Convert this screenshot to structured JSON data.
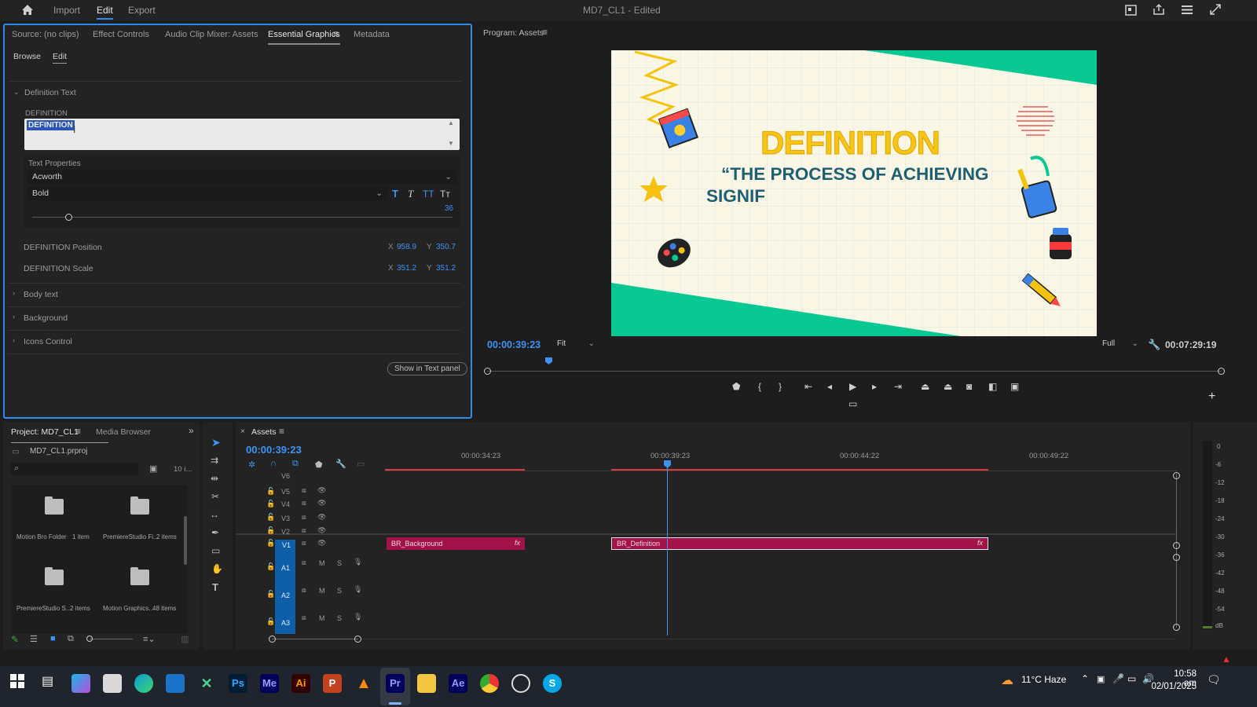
{
  "window": {
    "title": "MD7_CL1",
    "edited": "- Edited"
  },
  "menu": {
    "home": "home-icon",
    "import": "Import",
    "edit": "Edit",
    "export": "Export"
  },
  "eg_tabs": {
    "source": "Source: (no clips)",
    "effect": "Effect Controls",
    "mixer": "Audio Clip Mixer: Assets",
    "essential": "Essential Graphics",
    "metadata": "Metadata"
  },
  "eg": {
    "browse": "Browse",
    "edit": "Edit",
    "section_def": "Definition Text",
    "def_label": "DEFINITION",
    "def_value": "DEFINITION",
    "text_props": "Text Properties",
    "font": "Acworth",
    "weight": "Bold",
    "size": "36",
    "bold_T": "T",
    "italic_T": "T",
    "allcaps": "TT",
    "smallcaps": "Tт",
    "pos_label": "DEFINITION Position",
    "pos_x": "958.9",
    "pos_y": "350.7",
    "scale_label": "DEFINITION Scale",
    "scale_x": "351.2",
    "scale_y": "351.2",
    "x": "X",
    "y": "Y",
    "body": "Body text",
    "background": "Background",
    "icons": "Icons Control",
    "show_panel": "Show in Text panel"
  },
  "program": {
    "title": "Program: Assets",
    "timecode": "00:00:39:23",
    "fit": "Fit",
    "full": "Full",
    "duration": "00:07:29:19"
  },
  "video": {
    "headline": "DEFINITION",
    "quote": "“THE PROCESS OF ACHIEVING",
    "quote2": "SIGNIF"
  },
  "project": {
    "tab1": "Project: MD7_CL1",
    "tab2": "Media Browser",
    "file": "MD7_CL1.prproj",
    "count": "10 i...",
    "items": [
      {
        "name": "Motion Bro Folder",
        "count": "1 item"
      },
      {
        "name": "PremiereStudio Fi...",
        "count": "2 items"
      },
      {
        "name": "PremiereStudio S...",
        "count": "2 items"
      },
      {
        "name": "Motion Graphics...",
        "count": "48 items"
      }
    ]
  },
  "timeline": {
    "tab": "Assets",
    "timecode": "00:00:39:23",
    "ruler": [
      "00:00:34:23",
      "00:00:39:23",
      "00:00:44:22",
      "00:00:49:22"
    ],
    "tracks": [
      "V6",
      "V5",
      "V4",
      "V3",
      "V2",
      "V1"
    ],
    "audio": [
      "A1",
      "A2",
      "A3"
    ],
    "m": "M",
    "s": "S",
    "clip1": "BR_Background",
    "clip2": "BR_Definition",
    "fx": "fx"
  },
  "meter": {
    "labels": [
      "0",
      "-6",
      "-12",
      "-18",
      "-24",
      "-30",
      "-36",
      "-42",
      "-48",
      "-54",
      "dB"
    ]
  },
  "taskbar": {
    "weather": "11°C  Haze",
    "time": "10:58 am",
    "date": "02/01/2025",
    "apps": [
      "Ps",
      "Me",
      "Ai",
      "P",
      "Pr",
      "Ae",
      "S"
    ]
  }
}
